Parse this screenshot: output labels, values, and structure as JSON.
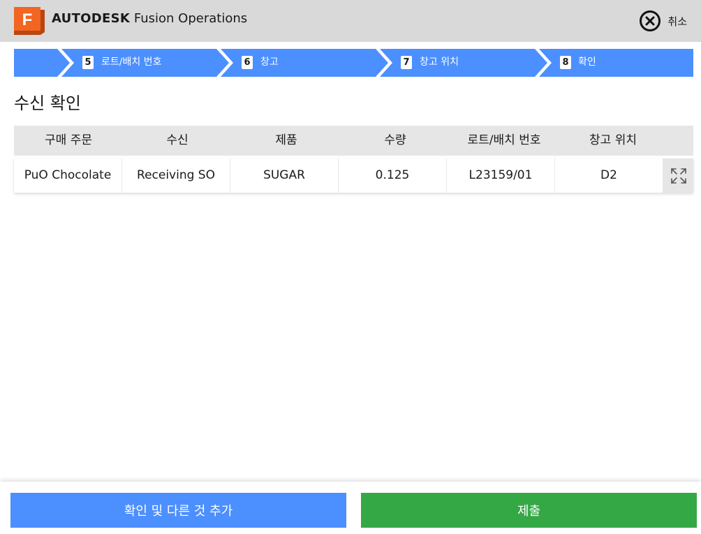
{
  "header": {
    "logo_letter": "F",
    "brand_bold": "AUTODESK",
    "brand_rest": "Fusion Operations",
    "cancel_label": "취소"
  },
  "colors": {
    "header_bg": "#d9d9d9",
    "step_bg": "#4c8fff",
    "secondary_button": "#4c8fff",
    "primary_button": "#35a846",
    "logo": "#f26522"
  },
  "steps": [
    {
      "number": "5",
      "label": "로트/배치 번호"
    },
    {
      "number": "6",
      "label": "창고"
    },
    {
      "number": "7",
      "label": "창고 위치"
    },
    {
      "number": "8",
      "label": "확인"
    }
  ],
  "page_title": "수신 확인",
  "table": {
    "headers": [
      "구매 주문",
      "수신",
      "제품",
      "수량",
      "로트/배치 번호",
      "창고 위치"
    ],
    "rows": [
      [
        "PuO Chocolate",
        "Receiving SO",
        "SUGAR",
        "0.125",
        "L23159/01",
        "D2"
      ]
    ],
    "expand_icon": "expand-icon"
  },
  "footer": {
    "secondary_label": "확인 및 다른 것 추가",
    "primary_label": "제출"
  }
}
